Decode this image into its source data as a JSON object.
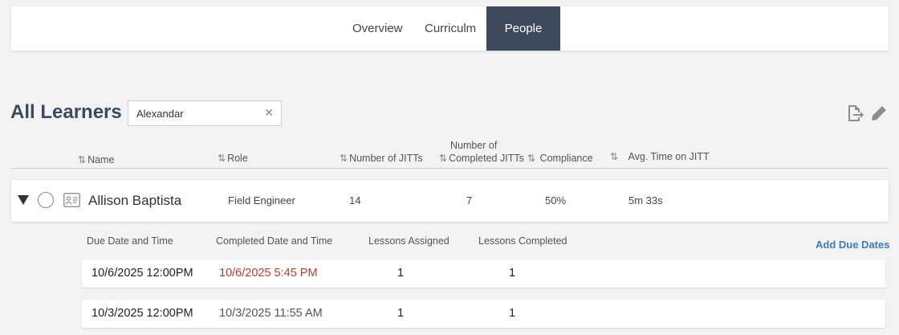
{
  "nav": {
    "tabs": [
      {
        "label": "Overview",
        "active": false
      },
      {
        "label": "Curriculm",
        "active": false
      },
      {
        "label": "People",
        "active": true
      }
    ]
  },
  "page": {
    "title": "All Learners",
    "search_value": "Alexandar"
  },
  "toolbar": {
    "export_icon": "export-icon",
    "edit_icon": "pencil-icon"
  },
  "table": {
    "headers": {
      "name": "Name",
      "role": "Role",
      "jitts": "Number of JITTs",
      "completed_1": "Number of",
      "completed_2": "Completed JITTs",
      "compliance": "Compliance",
      "avg_time": "Avg. Time on JITT"
    },
    "learner": {
      "name": "Allison Baptista",
      "role": "Field Engineer",
      "jitts": "14",
      "completed": "7",
      "compliance": "50%",
      "avg_time": "5m 33s"
    }
  },
  "detail": {
    "headers": {
      "due": "Due Date and Time",
      "completed": "Completed Date and Time",
      "assigned": "Lessons Assigned",
      "lessons_completed": "Lessons Completed"
    },
    "add_due_dates": "Add Due Dates",
    "rows": [
      {
        "due": "10/6/2025 12:00PM",
        "completed": "10/6/2025 5:45 PM",
        "late": true,
        "assigned": "1",
        "lessons_completed": "1"
      },
      {
        "due": "10/3/2025 12:00PM",
        "completed": "10/3/2025 11:55 AM",
        "late": false,
        "assigned": "1",
        "lessons_completed": "1"
      }
    ]
  },
  "colors": {
    "accent": "#3d4a5e",
    "link": "#3b7bbf",
    "late": "#c0392b"
  }
}
